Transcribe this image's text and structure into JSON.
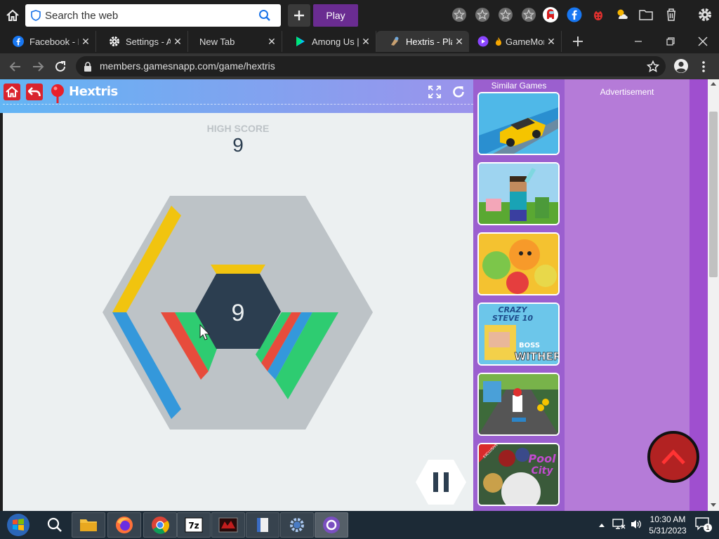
{
  "search": {
    "placeholder": "Search the web"
  },
  "toolbar": {
    "play_label": "Play"
  },
  "tabs": [
    {
      "label": "Facebook - Log",
      "icon": "facebook-icon"
    },
    {
      "label": "Settings - About",
      "icon": "gear-icon"
    },
    {
      "label": "New Tab",
      "icon": ""
    },
    {
      "label": "Among Us | Play",
      "icon": "play-store-icon"
    },
    {
      "label": "Hextris - Play",
      "icon": "hextris-icon",
      "active": true
    },
    {
      "label": "GameMonetize",
      "icon": "gamemonetize-icon"
    }
  ],
  "address": {
    "url": "members.gamesnapp.com/game/hextris"
  },
  "game": {
    "title": "Hextris",
    "high_score_label": "HIGH SCORE",
    "high_score": "9",
    "current_score": "9"
  },
  "sidebar": {
    "title": "Similar Games",
    "games": [
      "Car racing stunt game",
      "Minecraft style game",
      "Fruit match game",
      "Crazy Steve Boss Wither",
      "Subway runner game",
      "Pool City"
    ]
  },
  "ad": {
    "label": "Advertisement"
  },
  "thumb_text": {
    "crazy": "CRAZY",
    "steve": "STEVE 10",
    "boss": "BOSS",
    "wither": "WITHER",
    "exclusive": "EXCLUSIVE",
    "pool": "Pool",
    "city": "City"
  },
  "taskbar": {
    "time": "10:30 AM",
    "date": "5/31/2023",
    "notifications": "1"
  },
  "colors": {
    "hex_yellow": "#f1c40f",
    "hex_blue": "#3498db",
    "hex_green": "#2ecc71",
    "hex_red": "#e74c3c",
    "hex_center": "#2c3e50",
    "hex_outer": "#bdc3c7"
  }
}
